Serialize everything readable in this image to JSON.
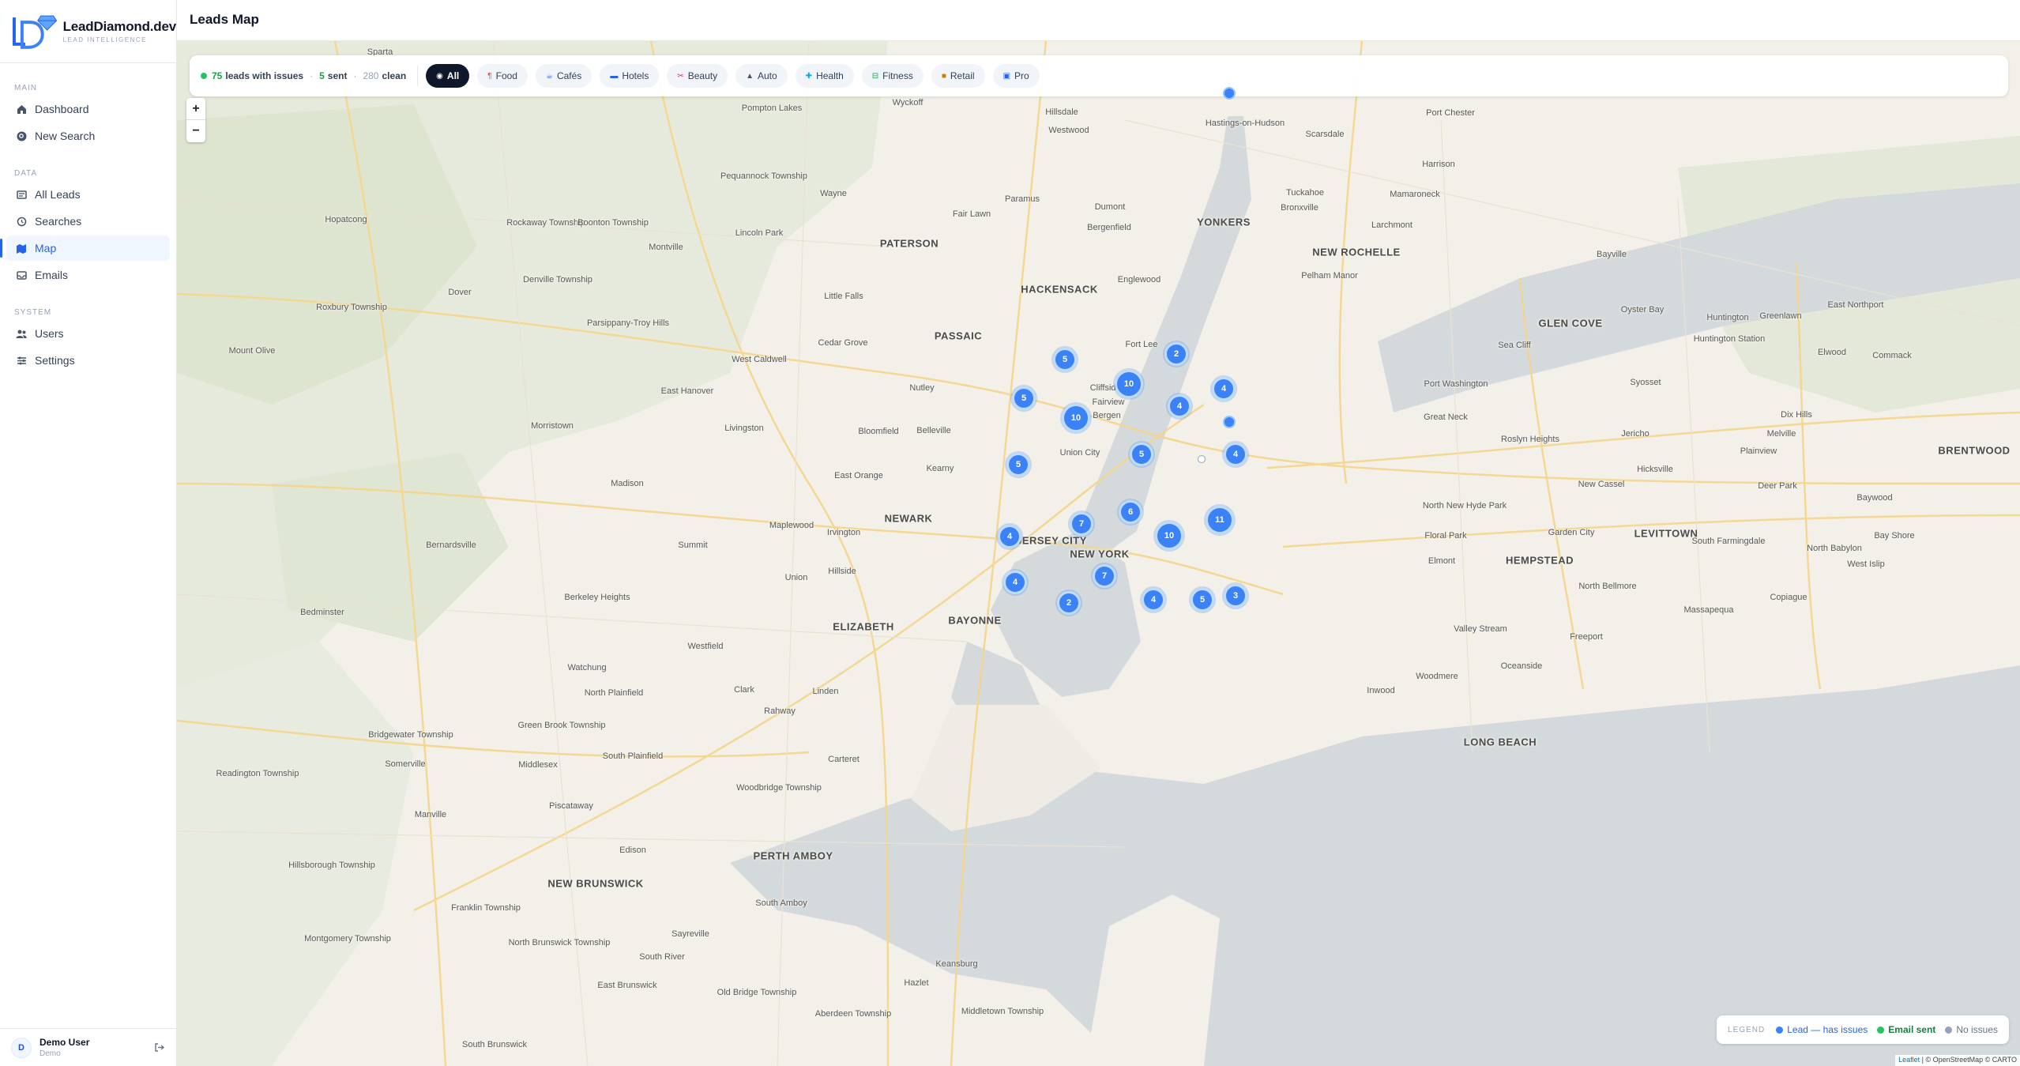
{
  "brand": {
    "name": "LeadDiamond.dev",
    "tagline": "LEAD INTELLIGENCE"
  },
  "sidebar": {
    "sections": [
      {
        "title": "MAIN",
        "items": [
          {
            "label": "Dashboard",
            "icon": "home-icon"
          },
          {
            "label": "New Search",
            "icon": "search-circle-icon"
          }
        ]
      },
      {
        "title": "DATA",
        "items": [
          {
            "label": "All Leads",
            "icon": "leads-icon"
          },
          {
            "label": "Searches",
            "icon": "history-icon"
          },
          {
            "label": "Map",
            "icon": "map-icon",
            "active": true
          },
          {
            "label": "Emails",
            "icon": "inbox-icon"
          }
        ]
      },
      {
        "title": "SYSTEM",
        "items": [
          {
            "label": "Users",
            "icon": "users-icon"
          },
          {
            "label": "Settings",
            "icon": "sliders-icon"
          }
        ]
      }
    ]
  },
  "user": {
    "initial": "D",
    "name": "Demo User",
    "role": "Demo"
  },
  "header": {
    "title": "Leads Map"
  },
  "stats": {
    "issues_count": "75",
    "issues_label": "leads with issues",
    "sent_count": "5",
    "sent_label": "sent",
    "clean_count": "280",
    "clean_label": "clean",
    "separator": "·"
  },
  "filters": [
    {
      "label": "All",
      "icon": "all-icon",
      "active": true
    },
    {
      "label": "Food",
      "icon": "food-icon"
    },
    {
      "label": "Cafés",
      "icon": "cafe-icon"
    },
    {
      "label": "Hotels",
      "icon": "hotel-icon"
    },
    {
      "label": "Beauty",
      "icon": "beauty-icon"
    },
    {
      "label": "Auto",
      "icon": "car-icon"
    },
    {
      "label": "Health",
      "icon": "health-icon"
    },
    {
      "label": "Fitness",
      "icon": "fitness-icon"
    },
    {
      "label": "Retail",
      "icon": "retail-icon"
    },
    {
      "label": "Pro",
      "icon": "briefcase-icon"
    }
  ],
  "zoom": {
    "in": "+",
    "out": "−"
  },
  "clusters": [
    "5",
    "10",
    "2",
    "5",
    "10",
    "4",
    "4",
    "4",
    "5",
    "5",
    "6",
    "11",
    "7",
    "10",
    "4",
    "7",
    "4",
    "2",
    "4",
    "5",
    "3"
  ],
  "places": {
    "major": [
      "YONKERS",
      "NEW ROCHELLE",
      "PATERSON",
      "HACKENSACK",
      "PASSAIC",
      "NEWARK",
      "NEW YORK",
      "JERSEY CITY",
      "BAYONNE",
      "ELIZABETH",
      "PERTH AMBOY",
      "NEW BRUNSWICK",
      "GLEN COVE",
      "HEMPSTEAD",
      "LEVITTOWN",
      "LONG BEACH",
      "BRENTWOOD"
    ],
    "minor": [
      "Sparta",
      "Wyckoff",
      "Hillsdale",
      "Westwood",
      "Pompton Lakes",
      "Pequannock Township",
      "Wayne",
      "Paramus",
      "Dumont",
      "Bergenfield",
      "Fair Lawn",
      "Hopatcong",
      "Rockaway Township",
      "Boonton Township",
      "Montville",
      "Lincoln Park",
      "Denville Township",
      "Dover",
      "Roxbury Township",
      "Mount Olive",
      "Parsippany-Troy Hills",
      "East Hanover",
      "West Caldwell",
      "Cedar Grove",
      "Little Falls",
      "Nutley",
      "Bloomfield",
      "Belleville",
      "Livingston",
      "Morristown",
      "Cliffside Park",
      "Fairview",
      "Bergen",
      "Fort Lee",
      "Englewood",
      "Union City",
      "Kearny",
      "East Orange",
      "Maplewood",
      "Irvington",
      "Summit",
      "Madison",
      "Bernardsville",
      "Berkeley Heights",
      "Hillside",
      "Union",
      "Bedminster",
      "Westfield",
      "Watchung",
      "North Plainfield",
      "Clark",
      "Linden",
      "Rahway",
      "Carteret",
      "Green Brook Township",
      "Bridgewater Township",
      "Somerville",
      "Middlesex",
      "South Plainfield",
      "Readington Township",
      "Manville",
      "Piscataway",
      "Woodbridge Township",
      "Edison",
      "Hillsborough Township",
      "Franklin Township",
      "Montgomery Township",
      "North Brunswick Township",
      "Sayreville",
      "South Amboy",
      "South River",
      "East Brunswick",
      "Old Bridge Township",
      "Keansburg",
      "Hazlet",
      "Aberdeen Township",
      "Middletown Township",
      "South Brunswick",
      "Hastings-on-Hudson",
      "Scarsdale",
      "Port Chester",
      "Harrison",
      "Mamaroneck",
      "Tuckahoe",
      "Bronxville",
      "Larchmont",
      "Pelham Manor",
      "Bayville",
      "Oyster Bay",
      "Huntington",
      "Greenlawn",
      "East Northport",
      "Huntington Station",
      "Elwood",
      "Commack",
      "Sea Cliff",
      "Port Washington",
      "Syosset",
      "Great Neck",
      "Roslyn Heights",
      "Jericho",
      "Dix Hills",
      "Melville",
      "Plainview",
      "Hicksville",
      "New Cassel",
      "Deer Park",
      "Baywood",
      "North New Hyde Park",
      "Floral Park",
      "Garden City",
      "Elmont",
      "South Farmingdale",
      "North Babylon",
      "West Islip",
      "Bay Shore",
      "North Bellmore",
      "Massapequa",
      "Copiague",
      "Valley Stream",
      "Freeport",
      "Oceanside",
      "Woodmere",
      "Inwood"
    ]
  },
  "legend": {
    "title": "LEGEND",
    "issues": "Lead — has issues",
    "sent": "Email sent",
    "clean": "No issues",
    "colors": {
      "issues": "#3b82f6",
      "sent": "#22c55e",
      "clean": "#94a3b8"
    }
  },
  "attribution": {
    "leaflet": "Leaflet",
    "rest": "| © OpenStreetMap © CARTO"
  }
}
